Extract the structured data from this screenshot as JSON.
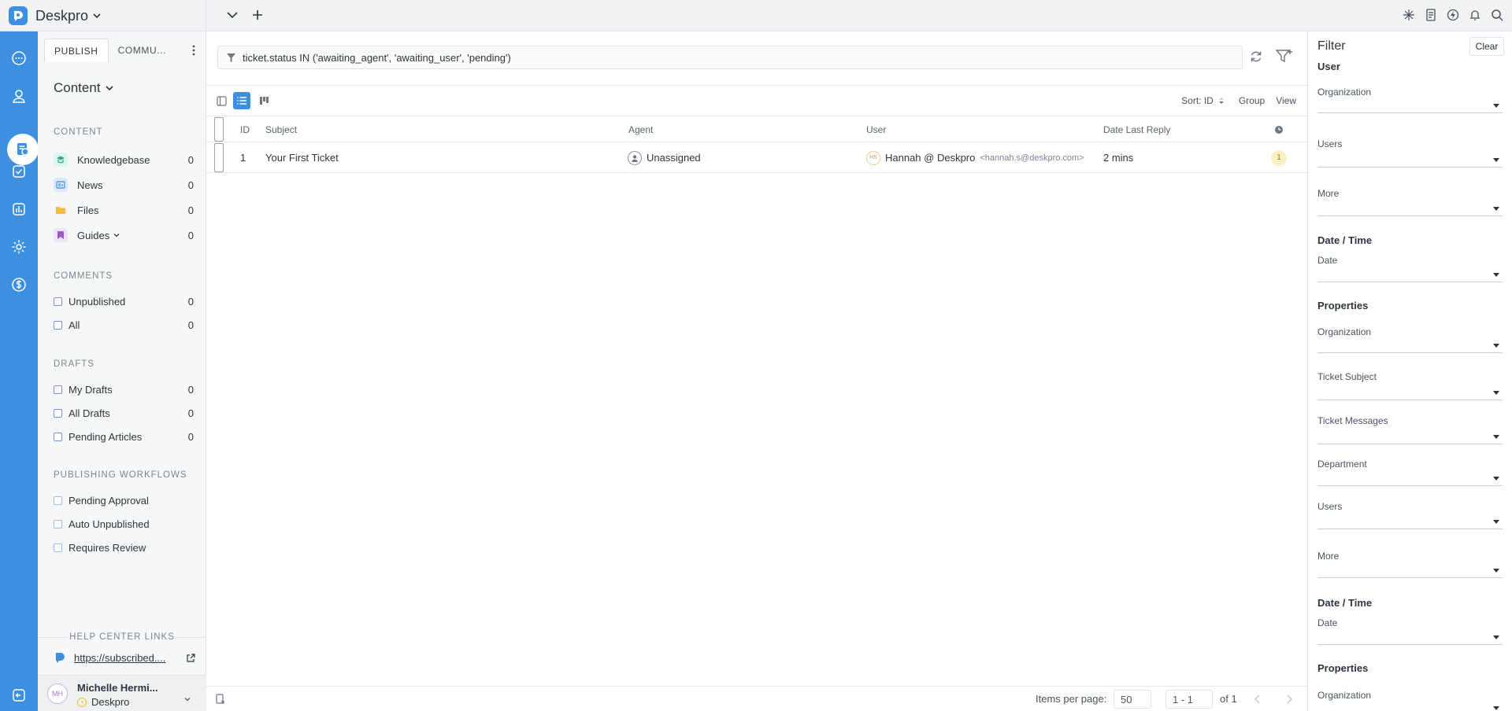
{
  "app": {
    "brand": "Deskpro"
  },
  "left_panel": {
    "tabs": [
      {
        "label": "PUBLISH"
      },
      {
        "label": "COMMU..."
      }
    ],
    "title": "Content",
    "sections": {
      "content": {
        "heading": "CONTENT",
        "items": [
          {
            "label": "Knowledgebase",
            "count": "0"
          },
          {
            "label": "News",
            "count": "0"
          },
          {
            "label": "Files",
            "count": "0"
          },
          {
            "label": "Guides",
            "count": "0"
          }
        ]
      },
      "comments": {
        "heading": "COMMENTS",
        "items": [
          {
            "label": "Unpublished",
            "count": "0"
          },
          {
            "label": "All",
            "count": "0"
          }
        ]
      },
      "drafts": {
        "heading": "DRAFTS",
        "items": [
          {
            "label": "My Drafts",
            "count": "0"
          },
          {
            "label": "All Drafts",
            "count": "0"
          },
          {
            "label": "Pending Articles",
            "count": "0"
          }
        ]
      },
      "workflows": {
        "heading": "PUBLISHING WORKFLOWS",
        "items": [
          {
            "label": "Pending Approval"
          },
          {
            "label": "Auto Unpublished"
          },
          {
            "label": "Requires Review"
          }
        ]
      }
    },
    "help_center": {
      "heading": "HELP CENTER LINKS",
      "url": "https://subscribed...."
    },
    "user": {
      "initials": "MH",
      "name": "Michelle Hermi...",
      "org": "Deskpro"
    }
  },
  "main": {
    "filter_query": "ticket.status IN ('awaiting_agent', 'awaiting_user', 'pending')",
    "toolbar": {
      "sort_label": "Sort: ID",
      "group_label": "Group",
      "view_label": "View"
    },
    "columns": {
      "id": "ID",
      "subject": "Subject",
      "agent": "Agent",
      "user": "User",
      "date": "Date Last Reply"
    },
    "rows": [
      {
        "id": "1",
        "subject": "Your First Ticket",
        "agent": "Unassigned",
        "user_initials": "HS",
        "user": "Hannah @ Deskpro",
        "email": "<hannah.s@deskpro.com>",
        "date": "2 mins",
        "badge": "1"
      }
    ],
    "footer": {
      "items_per_page_label": "Items per page:",
      "items_per_page": "50",
      "range": "1 - 1",
      "of": "of 1"
    }
  },
  "filter_panel": {
    "title": "Filter",
    "clear": "Clear",
    "fields": {
      "h_user": "User",
      "organization_1": "Organization",
      "users_1": "Users",
      "more_1": "More",
      "h_datetime_1": "Date / Time",
      "date_1": "Date",
      "h_properties_1": "Properties",
      "organization_2": "Organization",
      "ticket_subject": "Ticket Subject",
      "ticket_messages": "Ticket Messages",
      "department": "Department",
      "users_2": "Users",
      "more_2": "More",
      "h_datetime_2": "Date / Time",
      "date_2": "Date",
      "h_properties_2": "Properties",
      "organization_3": "Organization"
    }
  },
  "colors": {
    "brand": "#3d8fe0",
    "rail": "#3d8fe0",
    "badge_bg": "#fdf1c4"
  }
}
